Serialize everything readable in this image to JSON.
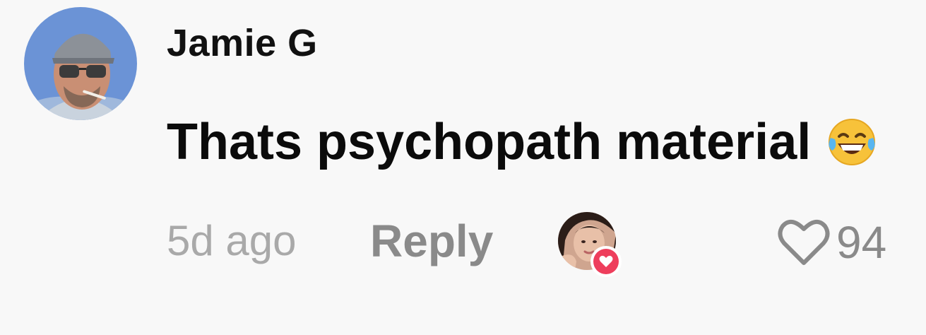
{
  "comment": {
    "username": "Jamie G",
    "text": "Thats psychopath material",
    "emoji": "face-with-tears-of-joy",
    "timestamp": "5d ago",
    "reply_label": "Reply",
    "like_count": "94"
  },
  "colors": {
    "background": "#f8f8f8",
    "username": "#111111",
    "text": "#0b0b0b",
    "timestamp": "#a9a9a9",
    "secondary": "#8a8a8a",
    "heart_badge": "#ee3e5c"
  },
  "icons": {
    "like": "heart-outline-icon",
    "creator_liked": "heart-badge-icon"
  }
}
